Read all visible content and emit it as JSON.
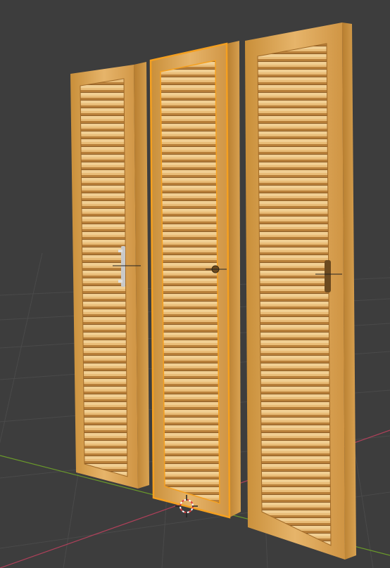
{
  "viewport": {
    "background": "#3d3d3d",
    "grid_color": "#4a4a4a",
    "x_axis_color": "#b0405a",
    "y_axis_color": "#6a9a2a",
    "selection_color": "#f5a020"
  },
  "objects": [
    {
      "name": "shutter-left",
      "handle": "bar-handle",
      "selected": false
    },
    {
      "name": "shutter-middle",
      "handle": "knob",
      "selected": true
    },
    {
      "name": "shutter-right",
      "handle": "latch",
      "selected": false
    }
  ],
  "icons": [
    "origin-icon",
    "3d-cursor-icon"
  ]
}
